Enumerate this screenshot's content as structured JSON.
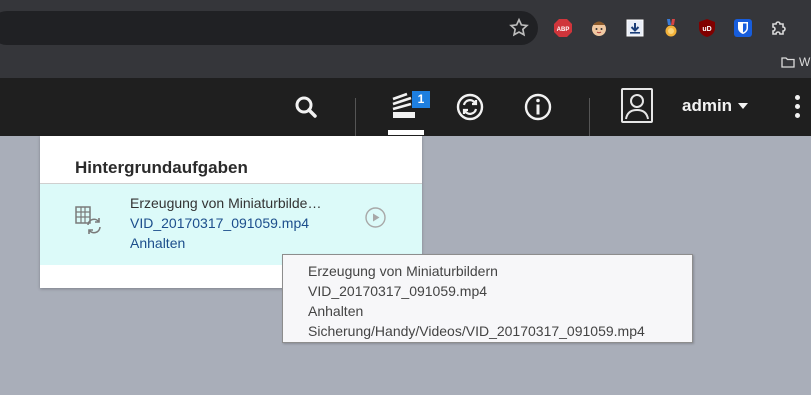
{
  "browser": {
    "bookmark_label": "W",
    "extensions": [
      "abp-icon",
      "face-extension-icon",
      "download-extension-icon",
      "medal-extension-icon",
      "ublock-icon",
      "bitwarden-icon",
      "puzzle-icon"
    ],
    "abp_text": "ABP",
    "ublock_text": "uD"
  },
  "header": {
    "notification_count": "1",
    "username": "admin"
  },
  "panel": {
    "title": "Hintergrundaufgaben",
    "task": {
      "title": "Erzeugung von Miniaturbilde…",
      "file": "VID_20170317_091059.mp4",
      "action": "Anhalten"
    }
  },
  "tooltip": {
    "line1": "Erzeugung von Miniaturbildern",
    "line2": "VID_20170317_091059.mp4",
    "line3": "Anhalten",
    "line4": "Sicherung/Handy/Videos/VID_20170317_091059.mp4"
  }
}
